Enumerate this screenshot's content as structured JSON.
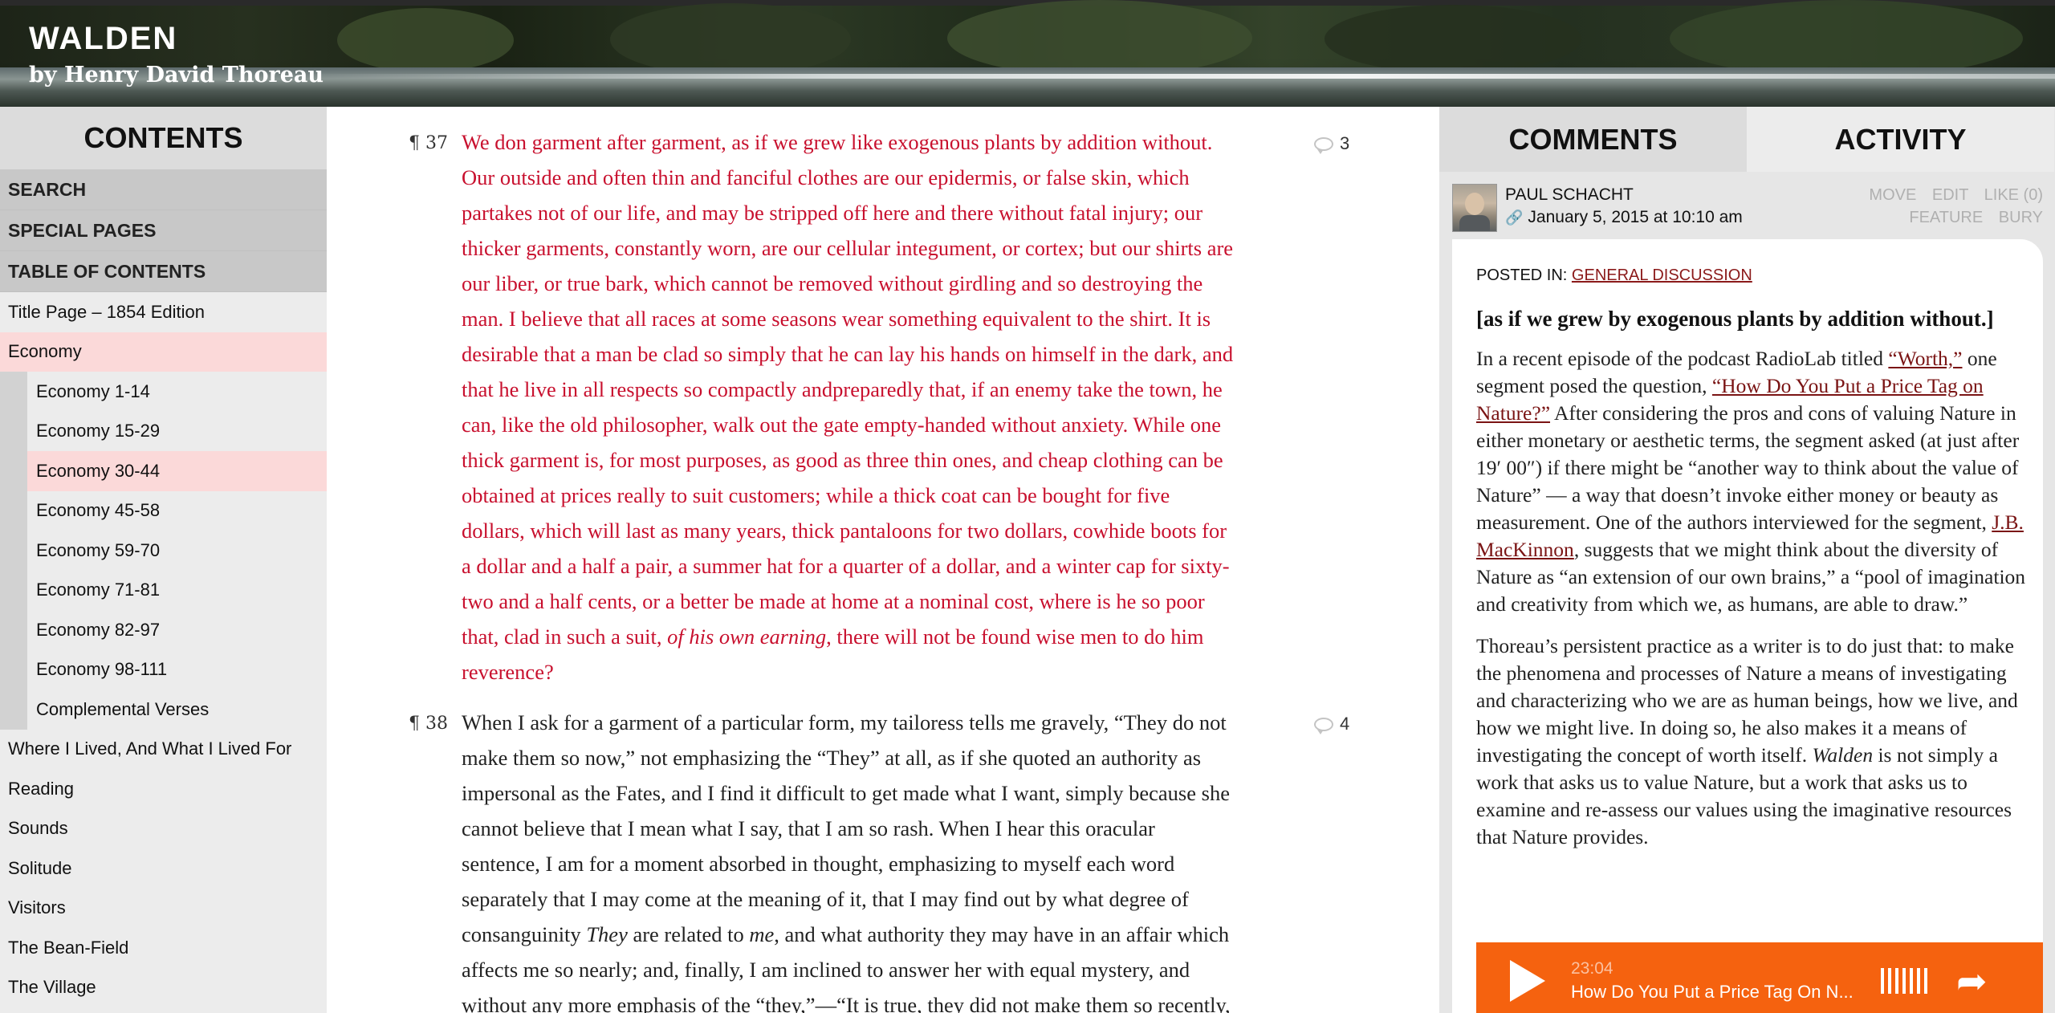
{
  "header": {
    "title": "WALDEN",
    "subtitle": "by Henry David Thoreau"
  },
  "sidebar": {
    "contents_label": "CONTENTS",
    "sections": [
      {
        "label": "SEARCH"
      },
      {
        "label": "SPECIAL PAGES"
      },
      {
        "label": "TABLE OF CONTENTS"
      }
    ],
    "toc": [
      {
        "label": "Title Page – 1854 Edition",
        "level": 0,
        "active": false
      },
      {
        "label": "Economy",
        "level": 0,
        "active": true
      },
      {
        "label": "Economy 1-14",
        "level": 1,
        "active": false
      },
      {
        "label": "Economy 15-29",
        "level": 1,
        "active": false
      },
      {
        "label": "Economy 30-44",
        "level": 1,
        "active": true
      },
      {
        "label": "Economy 45-58",
        "level": 1,
        "active": false
      },
      {
        "label": "Economy 59-70",
        "level": 1,
        "active": false
      },
      {
        "label": "Economy 71-81",
        "level": 1,
        "active": false
      },
      {
        "label": "Economy 82-97",
        "level": 1,
        "active": false
      },
      {
        "label": "Economy 98-111",
        "level": 1,
        "active": false
      },
      {
        "label": "Complemental Verses",
        "level": 1,
        "active": false
      },
      {
        "label": "Where I Lived, And What I Lived For",
        "level": 0,
        "active": false
      },
      {
        "label": "Reading",
        "level": 0,
        "active": false
      },
      {
        "label": "Sounds",
        "level": 0,
        "active": false
      },
      {
        "label": "Solitude",
        "level": 0,
        "active": false
      },
      {
        "label": "Visitors",
        "level": 0,
        "active": false
      },
      {
        "label": "The Bean-Field",
        "level": 0,
        "active": false
      },
      {
        "label": "The Village",
        "level": 0,
        "active": false
      }
    ]
  },
  "main": {
    "paragraphs": [
      {
        "number": "¶ 37",
        "comments": "3",
        "highlight": true,
        "lines": [
          "We don garment after garment, as if we grew like exogenous plants by addition without.",
          "Our outside and often thin and fanciful clothes are our epidermis, or false skin, which",
          "partakes not of our life, and may be stripped off here and there without fatal injury; our",
          "thicker garments, constantly worn, are our cellular integument, or cortex; but our shirts are",
          "our liber, or true bark, which cannot be removed without girdling and so destroying the",
          "man. I believe that all races at some seasons wear something equivalent to the shirt. It is",
          "desirable that a man be clad so simply that he can lay his hands on himself in the dark, and",
          "that he live in all respects so compactly andpreparedly that, if an enemy take the town, he",
          "can, like the old philosopher, walk out the gate empty-handed without anxiety. While one",
          "thick garment is, for most purposes, as good as three thin ones, and cheap clothing can be",
          "obtained at prices really to suit customers; while a thick coat can be bought for five",
          "dollars, which will last as many years, thick pantaloons for two dollars, cowhide boots for",
          "a dollar and a half a pair, a summer hat for a quarter of a dollar, and a winter cap for sixty-",
          "two and a half cents, or a better be made at home at a nominal cost, where is he so poor",
          "that, clad in such a suit, ",
          "reverence?"
        ],
        "italic_phrase": "of his own earning",
        "after_italic": ", there will not be found wise men to do him"
      },
      {
        "number": "¶ 38",
        "comments": "4",
        "highlight": false,
        "lines": [
          "When I ask for a garment of a particular form, my tailoress tells me gravely, “They do not",
          "make them so now,” not emphasizing the “They” at all, as if she quoted an authority as",
          "impersonal as the Fates, and I find it difficult to get made what I want, simply because she",
          "cannot believe that I mean what I say, that I am so rash. When I hear this oracular",
          "sentence, I am for a moment absorbed in thought, emphasizing to myself each word",
          "separately that I may come at the meaning of it, that I may find out by what degree of",
          "consanguinity ",
          "affects me so nearly; and, finally, I am inclined to answer her with equal mystery, and",
          "without any more emphasis of the “they,”—“It is true, they did not make them so recently,"
        ],
        "line7_italic1": "They",
        "line7_mid": " are related to ",
        "line7_italic2": "me",
        "line7_end": ", and what authority they may have in an affair which"
      }
    ]
  },
  "right_panel": {
    "tabs": [
      "COMMENTS",
      "ACTIVITY"
    ],
    "comment": {
      "author": "PAUL SCHACHT",
      "timestamp": "January 5, 2015 at 10:10 am",
      "actions_row1": [
        "MOVE",
        "EDIT",
        "LIKE (0)"
      ],
      "actions_row2": [
        "FEATURE",
        "BURY"
      ],
      "posted_in_label": "POSTED IN:",
      "posted_in_link": "GENERAL DISCUSSION",
      "quote": "[as if we grew by exogenous plants by addition without.]",
      "p1_a": "In a recent episode of the podcast RadioLab titled ",
      "p1_link1": "“Worth,”",
      "p1_b": " one segment posed the question, ",
      "p1_link2": "“How Do You Put a Price Tag on Nature?”",
      "p1_c": " After considering the pros and cons of valuing Nature in either monetary or aesthetic terms, the segment asked (at just after 19′ 00″) if there might be “another way to think about the value of Nature” — a way that doesn’t invoke either money or beauty as measurement. One of the authors interviewed for the segment, ",
      "p1_link3": "J.B. MacKinnon",
      "p1_d": ",  suggests that we might think about the diversity of Nature as “an extension of our own brains,” a “pool of imagination and creativity from which we, as humans, are able to draw.”",
      "p2_a": "Thoreau’s persistent practice as a writer is to do just that: to make the phenomena and processes of Nature a means of investigating and characterizing who we are as human beings, how we live, and how we might live. In doing so, he also makes it a means of investigating the concept of worth itself. ",
      "p2_italic": "Walden",
      "p2_b": " is not simply a work that asks us to value Nature, but a work that asks us to examine and re-assess our values using the imaginative resources that Nature provides."
    },
    "player": {
      "time": "23:04",
      "title": "How Do You Put a Price Tag On N..."
    }
  }
}
